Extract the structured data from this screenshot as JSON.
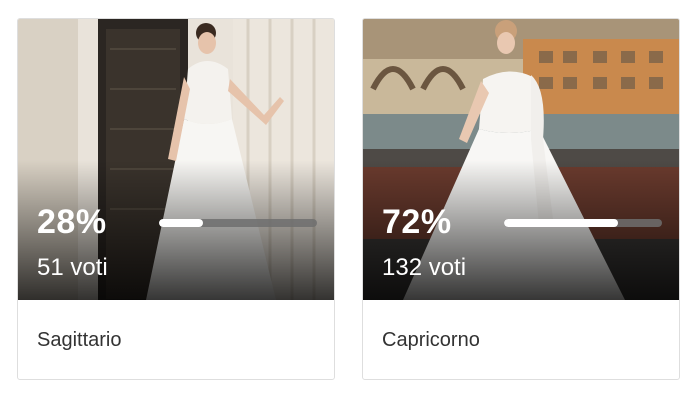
{
  "options": [
    {
      "name": "Sagittario",
      "percent_label": "28%",
      "votes_label": "51 voti",
      "percent": 0.28
    },
    {
      "name": "Capricorno",
      "percent_label": "72%",
      "votes_label": "132 voti",
      "percent": 0.72
    }
  ],
  "colors": {
    "text": "#333333",
    "bar_fill": "#ffffff",
    "bar_track": "#6e6e6e",
    "border": "#dedede"
  }
}
